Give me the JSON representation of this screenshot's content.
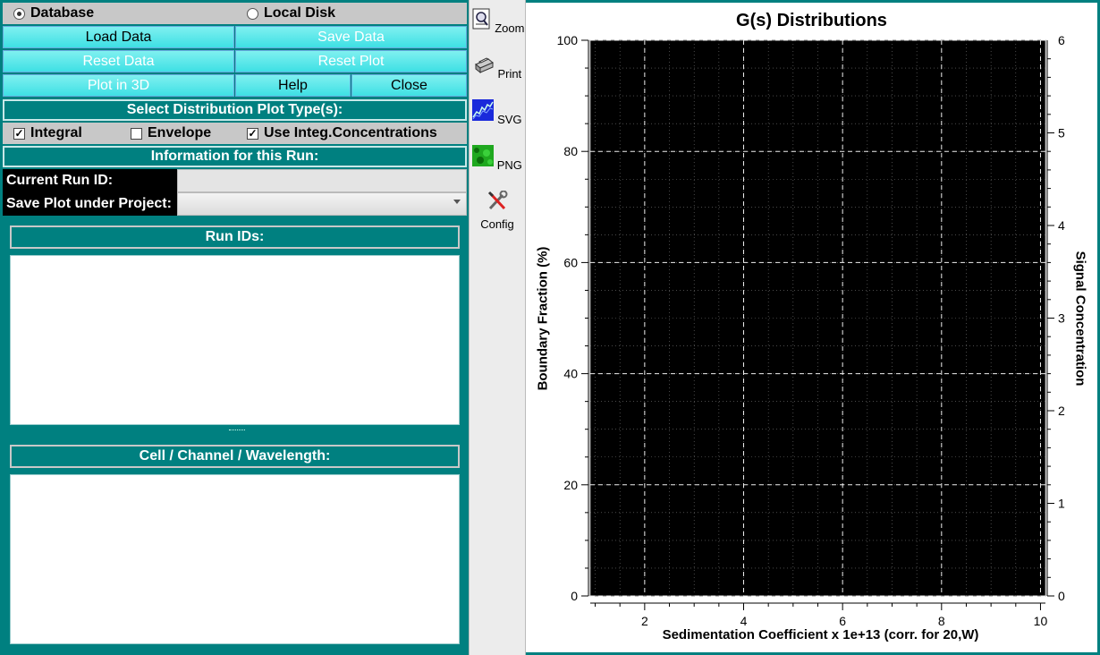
{
  "source": {
    "options": [
      "Database",
      "Local Disk"
    ],
    "selected": "Database"
  },
  "buttons": {
    "load_data": "Load Data",
    "save_data": "Save Data",
    "reset_data": "Reset Data",
    "reset_plot": "Reset Plot",
    "plot_3d": "Plot in 3D",
    "help": "Help",
    "close": "Close"
  },
  "plot_type": {
    "header": "Select Distribution Plot Type(s):",
    "options": [
      {
        "label": "Integral",
        "checked": true
      },
      {
        "label": "Envelope",
        "checked": false
      },
      {
        "label": "Use Integ.Concentrations",
        "checked": true
      }
    ]
  },
  "run_info": {
    "header": "Information for this Run:",
    "current_run_label": "Current Run ID:",
    "current_run_value": "",
    "project_label": "Save Plot under Project:",
    "project_value": ""
  },
  "lists": {
    "run_ids_title": "Run IDs:",
    "cells_title": "Cell / Channel / Wavelength:",
    "run_ids": [],
    "cells": []
  },
  "toolbar": [
    {
      "label": "Zoom",
      "icon": "zoom-icon"
    },
    {
      "label": "Print",
      "icon": "print-icon"
    },
    {
      "label": "SVG",
      "icon": "svg-icon"
    },
    {
      "label": "PNG",
      "icon": "png-icon"
    },
    {
      "label": "Config",
      "icon": "config-icon"
    }
  ],
  "chart_data": {
    "type": "line",
    "title": "G(s) Distributions",
    "xlabel": "Sedimentation Coefficient x 1e+13 (corr. for 20,W)",
    "ylabel": "Boundary Fraction (%)",
    "y2label": "Signal Concentration",
    "xlim": [
      0.9,
      10.1
    ],
    "ylim": [
      0,
      100
    ],
    "y2lim": [
      0,
      6
    ],
    "xticks": [
      2,
      4,
      6,
      8,
      10
    ],
    "yticks": [
      0,
      20,
      40,
      60,
      80,
      100
    ],
    "y2ticks": [
      0,
      1,
      2,
      3,
      4,
      5,
      6
    ],
    "background": "#000000",
    "grid": true,
    "series": []
  },
  "colors": {
    "panel": "#008080",
    "button": "#3ee0e4",
    "plot_canvas": "#000000"
  }
}
